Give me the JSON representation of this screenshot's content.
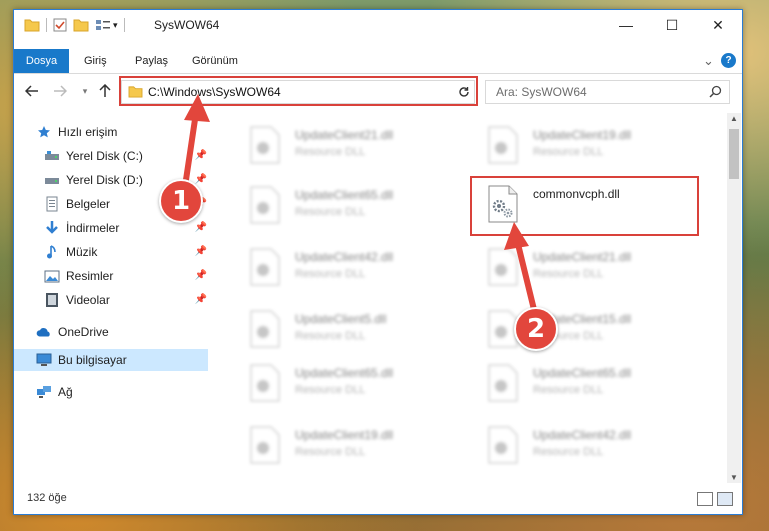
{
  "window": {
    "title": "SysWOW64",
    "minimize": "—",
    "maximize": "☐",
    "close": "✕"
  },
  "ribbon": {
    "tabs": [
      "Dosya",
      "Giriş",
      "Paylaş",
      "Görünüm"
    ],
    "collapse": "⌄",
    "help": "?"
  },
  "address": {
    "path": "C:\\Windows\\SysWOW64",
    "search_placeholder": "Ara: SysWOW64"
  },
  "nav": {
    "items": [
      {
        "label": "Hızlı erişim",
        "icon": "star-icon",
        "pinned": false
      },
      {
        "label": "Yerel Disk (C:)",
        "icon": "drive-icon",
        "pinned": true
      },
      {
        "label": "Yerel Disk (D:)",
        "icon": "drive-icon",
        "pinned": true
      },
      {
        "label": "Belgeler",
        "icon": "documents-icon",
        "pinned": true
      },
      {
        "label": "İndirmeler",
        "icon": "download-icon",
        "pinned": true
      },
      {
        "label": "Müzik",
        "icon": "music-icon",
        "pinned": true
      },
      {
        "label": "Resimler",
        "icon": "pictures-icon",
        "pinned": true
      },
      {
        "label": "Videolar",
        "icon": "video-icon",
        "pinned": true
      },
      {
        "label": "OneDrive",
        "icon": "cloud-icon",
        "pinned": false
      },
      {
        "label": "Bu bilgisayar",
        "icon": "computer-icon",
        "pinned": false
      },
      {
        "label": "Ağ",
        "icon": "network-icon",
        "pinned": false
      }
    ]
  },
  "files": [
    {
      "name": "UpdateClient21.dll",
      "type": "Resource DLL"
    },
    {
      "name": "UpdateClient19.dll",
      "type": "Resource DLL"
    },
    {
      "name": "UpdateClient65.dll",
      "type": "Resource DLL"
    },
    {
      "name": "commonvcph.dll",
      "type": ""
    },
    {
      "name": "UpdateClient42.dll",
      "type": "Resource DLL"
    },
    {
      "name": "UpdateClient21.dll",
      "type": "Resource DLL"
    },
    {
      "name": "UpdateClient5.dll",
      "type": "Resource DLL"
    },
    {
      "name": "UpdateClient15.dll",
      "type": "Resource DLL"
    },
    {
      "name": "UpdateClient65.dll",
      "type": "Resource DLL"
    },
    {
      "name": "UpdateClient65.dll",
      "type": "Resource DLL"
    },
    {
      "name": "UpdateClient19.dll",
      "type": "Resource DLL"
    },
    {
      "name": "UpdateClient42.dll",
      "type": "Resource DLL"
    }
  ],
  "status": {
    "count": "132 öğe"
  },
  "annotations": {
    "step1": "1",
    "step2": "2",
    "color": "#e2463c"
  }
}
